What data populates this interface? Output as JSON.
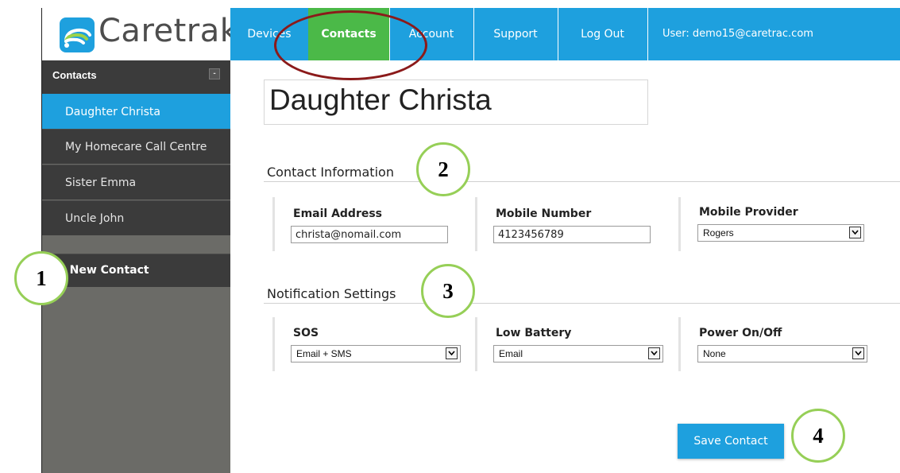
{
  "app": {
    "logo_text": "Caretrak"
  },
  "topnav": {
    "items": [
      {
        "label": "Devices"
      },
      {
        "label": "Contacts"
      },
      {
        "label": "Account"
      },
      {
        "label": "Support"
      },
      {
        "label": "Log Out"
      }
    ],
    "user": "User:  demo15@caretrac.com"
  },
  "sidebar": {
    "header": "Contacts",
    "collapse_symbol": "-",
    "items": [
      {
        "label": "Daughter Christa"
      },
      {
        "label": "My Homecare Call Centre"
      },
      {
        "label": "Sister Emma"
      },
      {
        "label": "Uncle John"
      }
    ],
    "new_contact": "+ New Contact"
  },
  "main": {
    "contact_name": "Daughter Christa",
    "contact_info": {
      "title": "Contact Information",
      "email_label": "Email Address",
      "email_value": "christa@nomail.com",
      "mobile_label": "Mobile Number",
      "mobile_value": "4123456789",
      "provider_label": "Mobile Provider",
      "provider_value": "Rogers"
    },
    "notifications": {
      "title": "Notification Settings",
      "sos_label": "SOS",
      "sos_value": "Email + SMS",
      "battery_label": "Low Battery",
      "battery_value": "Email",
      "power_label": "Power On/Off",
      "power_value": "None"
    },
    "save_label": "Save Contact"
  },
  "annotations": [
    "1",
    "2",
    "3",
    "4"
  ],
  "colors": {
    "nav_blue": "#1ea0de",
    "nav_active_green": "#4bb948",
    "sidebar_dark": "#3b3b3b",
    "annotation_green": "#96cf57",
    "highlight_ellipse": "#8b1a1a"
  }
}
